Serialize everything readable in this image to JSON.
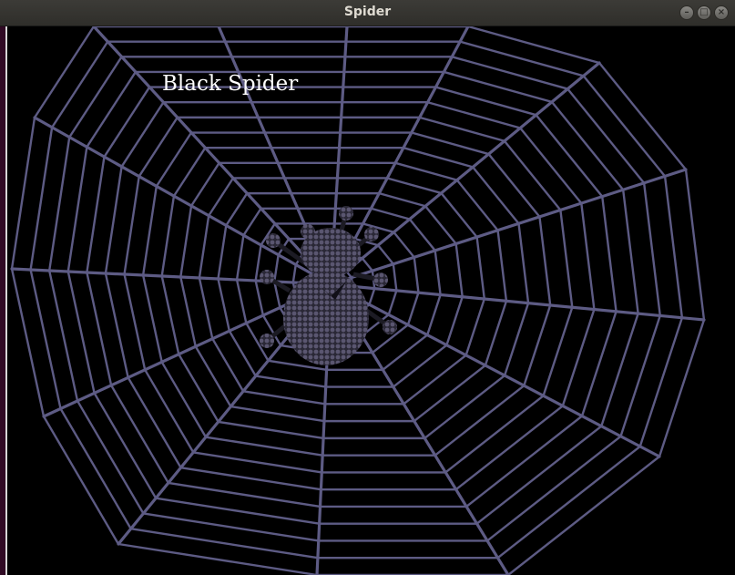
{
  "window": {
    "title": "Spider",
    "controls": [
      "minimize-icon",
      "maximize-icon",
      "close-icon"
    ]
  },
  "scene": {
    "caption": "Black Spider",
    "web_color": "#5d5b84",
    "background_color": "#000000",
    "spider_color": "#5a5670"
  }
}
